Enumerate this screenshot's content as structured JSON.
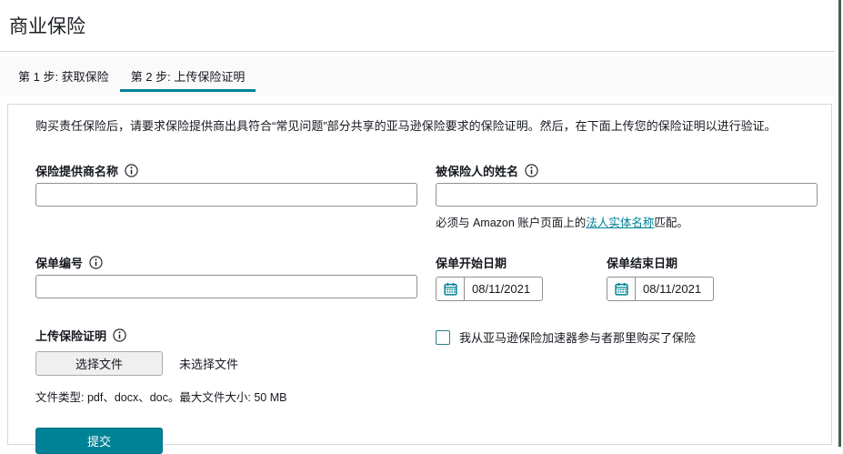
{
  "page": {
    "title": "商业保险"
  },
  "tabs": {
    "step1": "第 1 步: 获取保险",
    "step2": "第 2 步: 上传保险证明"
  },
  "intro": "购买责任保险后，请要求保险提供商出具符合“常见问题”部分共享的亚马逊保险要求的保险证明。然后，在下面上传您的保险证明以进行验证。",
  "form": {
    "provider": {
      "label": "保险提供商名称",
      "value": ""
    },
    "insured": {
      "label": "被保险人的姓名",
      "value": "",
      "helper_prefix": "必须与 Amazon 账户页面上的",
      "helper_link": "法人实体名称",
      "helper_suffix": "匹配。"
    },
    "policy_number": {
      "label": "保单编号",
      "value": ""
    },
    "start_date": {
      "label": "保单开始日期",
      "value": "08/11/2021"
    },
    "end_date": {
      "label": "保单结束日期",
      "value": "08/11/2021"
    },
    "upload": {
      "label": "上传保险证明",
      "choose_button": "选择文件",
      "no_file_text": "未选择文件",
      "note": "文件类型: pdf、docx、doc。最大文件大小: 50 MB"
    },
    "accelerator_checkbox": {
      "label": "我从亚马逊保险加速器参与者那里购买了保险",
      "checked": false
    },
    "submit_label": "提交"
  },
  "colors": {
    "accent": "#008296",
    "edge_line": "#46634a"
  }
}
